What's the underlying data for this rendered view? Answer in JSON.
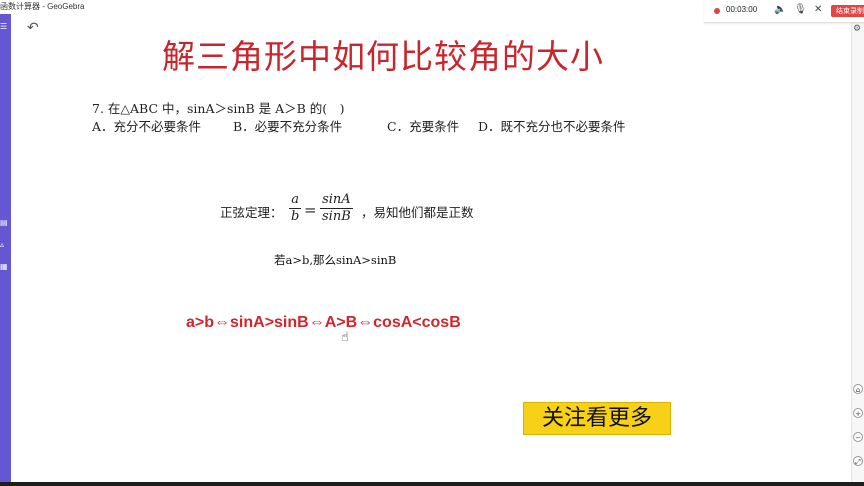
{
  "window": {
    "title": "函数计算器 - GeoGebra"
  },
  "recorder": {
    "time": "00:03:00",
    "end_label": "结束录制"
  },
  "slide": {
    "title": "解三角形中如何比较角的大小",
    "question": "7. 在△ABC 中，sinA＞sinB 是 A＞B 的(　)",
    "options": {
      "a": "A．充分不必要条件",
      "b": "B．必要不充分条件",
      "c": "C．充要条件",
      "d": "D．既不充分也不必要条件"
    },
    "sine_rule": {
      "label": "正弦定理：",
      "num_left": "a",
      "den_left": "b",
      "equals": "=",
      "num_right": "sinA",
      "den_right": "sinB",
      "suffix": "，易知他们都是正数"
    },
    "note": "若a>b,那么sinA>sinB",
    "chain": "a>b⇔sinA>sinB⇔A>B⇔cosA<cosB",
    "follow_button": "关注看更多"
  },
  "colors": {
    "accent": "#c8262c",
    "sidebar": "#6557d2",
    "follow_bg": "#f7d117"
  },
  "icons": {
    "menu": "menu-icon",
    "undo": "undo-icon",
    "settings": "gear-icon",
    "speaker": "speaker-icon",
    "mic": "mic-icon",
    "close": "close-icon",
    "cursor": "hand-cursor-icon"
  }
}
